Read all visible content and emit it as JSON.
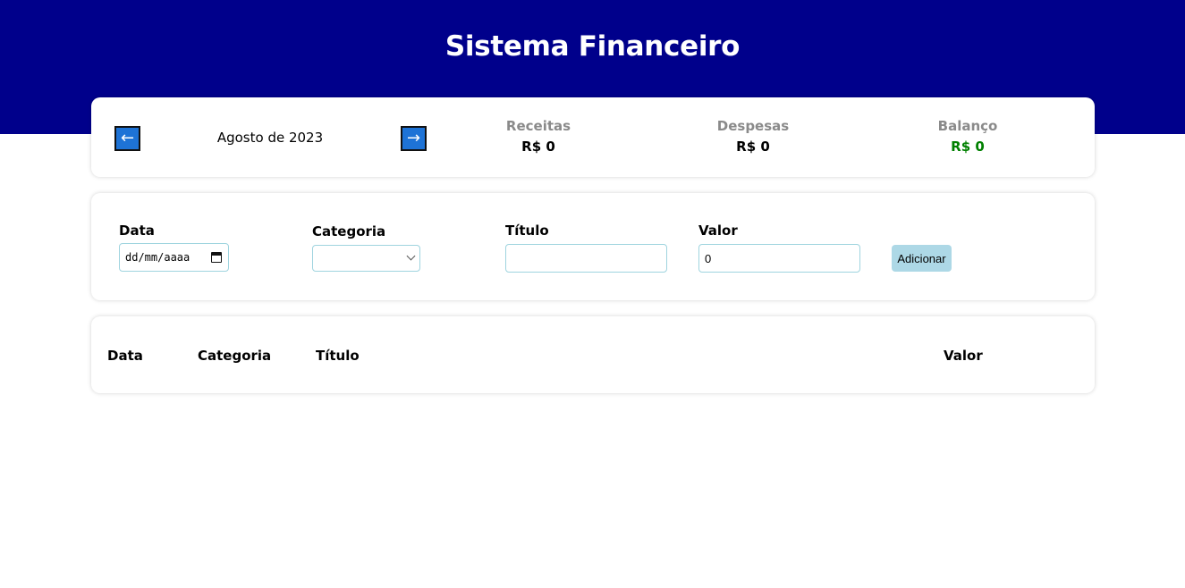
{
  "header": {
    "title": "Sistema Financeiro"
  },
  "info": {
    "prev_label": "←",
    "next_label": "→",
    "month": "Agosto de 2023",
    "receitas": {
      "title": "Receitas",
      "value": "R$ 0"
    },
    "despesas": {
      "title": "Despesas",
      "value": "R$ 0"
    },
    "balanco": {
      "title": "Balanço",
      "value": "R$ 0"
    }
  },
  "form": {
    "date": {
      "label": "Data",
      "placeholder": "dd/mm/aaaa"
    },
    "category": {
      "label": "Categoria",
      "value": ""
    },
    "title": {
      "label": "Título",
      "value": ""
    },
    "amount": {
      "label": "Valor",
      "value": "0"
    },
    "add_label": "Adicionar"
  },
  "table": {
    "columns": [
      "Data",
      "Categoria",
      "Título",
      "Valor"
    ]
  },
  "colors": {
    "header_bg": "#00008b",
    "arrow_bg": "#1e73d6",
    "balance": "#008000",
    "add_button": "#add8e6"
  },
  "icons": [
    "arrow-left-icon",
    "arrow-right-icon",
    "calendar-icon",
    "chevron-down-icon"
  ]
}
